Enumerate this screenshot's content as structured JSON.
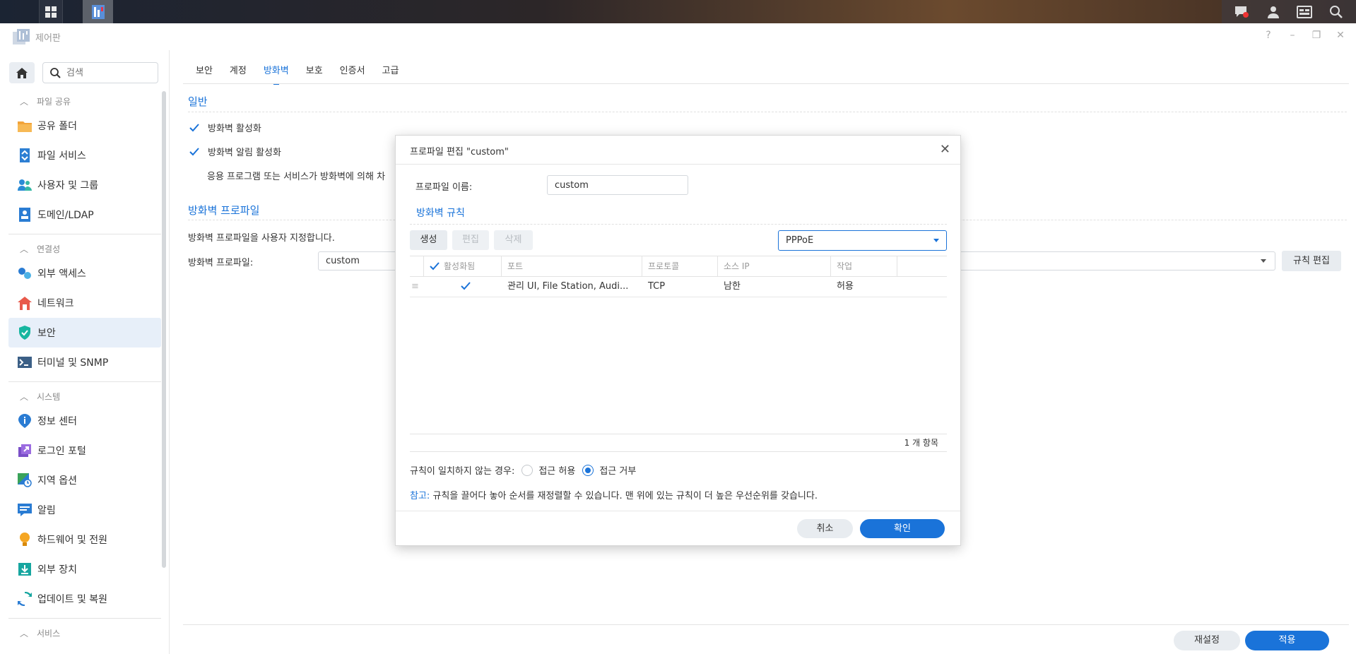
{
  "window": {
    "title": "제어판"
  },
  "search": {
    "placeholder": "검색"
  },
  "sidebar": {
    "sections": [
      {
        "label": "파일 공유",
        "items": [
          "공유 폴더",
          "파일 서비스",
          "사용자 및 그룹",
          "도메인/LDAP"
        ]
      },
      {
        "label": "연결성",
        "items": [
          "외부 액세스",
          "네트워크",
          "보안",
          "터미널 및 SNMP"
        ]
      },
      {
        "label": "시스템",
        "items": [
          "정보 센터",
          "로그인 포털",
          "지역 옵션",
          "알림",
          "하드웨어 및 전원",
          "외부 장치",
          "업데이트 및 복원"
        ]
      },
      {
        "label": "서비스",
        "items": []
      }
    ],
    "active_item": "보안"
  },
  "tabs": [
    "보안",
    "계정",
    "방화벽",
    "보호",
    "인증서",
    "고급"
  ],
  "active_tab": "방화벽",
  "general": {
    "title": "일반",
    "enable_firewall": "방화벽 활성화",
    "enable_notifications": "방화벽 알림 활성화",
    "desc": "응용 프로그램 또는 서비스가 방화벽에 의해 차"
  },
  "profile": {
    "title": "방화벽 프로파일",
    "desc": "방화벽 프로파일을 사용자 지정합니다.",
    "label": "방화벽 프로파일:",
    "value": "custom",
    "edit_rules": "규칙 편집"
  },
  "footer": {
    "reset": "재설정",
    "apply": "적용"
  },
  "modal": {
    "title": "프로파일 편집 \"custom\"",
    "name_label": "프로파일 이름:",
    "name_value": "custom",
    "rules_title": "방화벽 규칙",
    "buttons": {
      "create": "생성",
      "edit": "편집",
      "delete": "삭제"
    },
    "interface": "PPPoE",
    "columns": {
      "enabled": "활성화됨",
      "ports": "포트",
      "protocol": "프로토콜",
      "source_ip": "소스 IP",
      "action": "작업"
    },
    "rows": [
      {
        "ports": "관리 UI, File Station, Audi...",
        "protocol": "TCP",
        "source_ip": "남한",
        "action": "허용"
      }
    ],
    "count": "1 개 항목",
    "no_match_label": "규칙이 일치하지 않는 경우:",
    "allow": "접근 허용",
    "deny": "접근 거부",
    "note_label": "참고:",
    "note_text": "규칙을 끌어다 놓아 순서를 재정렬할 수 있습니다. 맨 위에 있는 규칙이 더 높은 우선순위를 갖습니다.",
    "cancel": "취소",
    "ok": "확인"
  },
  "colors": {
    "accent": "#1a73d9"
  }
}
